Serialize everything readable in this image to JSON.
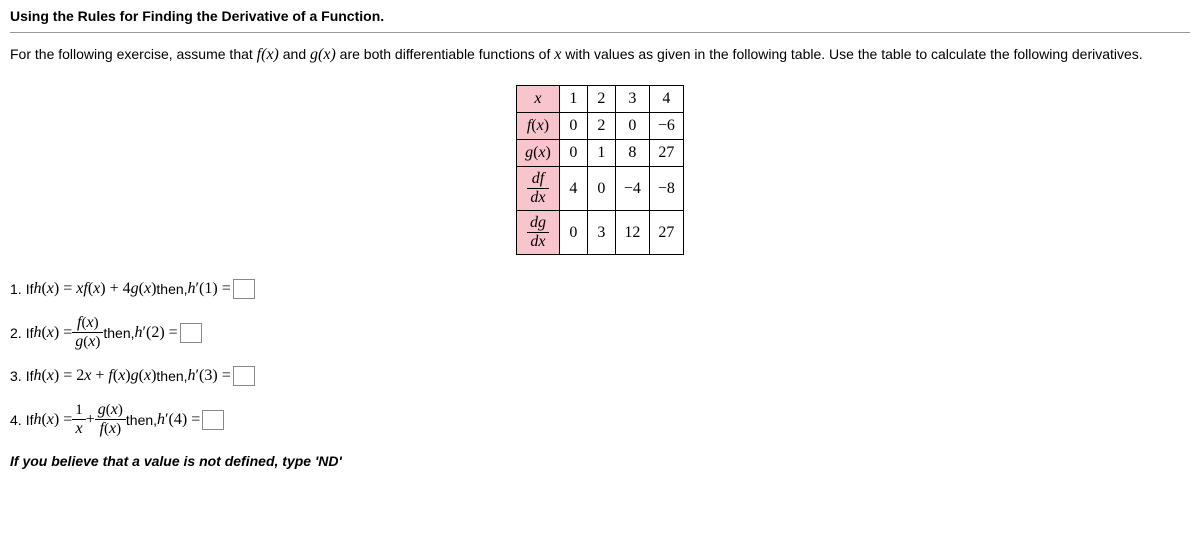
{
  "heading": "Using the Rules for Finding the Derivative of a Function.",
  "instructions_pre": "For the following exercise, assume that ",
  "instructions_f": "f(x)",
  "instructions_mid": " and ",
  "instructions_g": "g(x)",
  "instructions_post": " are both differentiable functions of ",
  "instructions_var": "x",
  "instructions_end": " with values as given in the following table. Use the table to calculate the following derivatives.",
  "table": {
    "rows": [
      {
        "label_html": "x",
        "vals": [
          "1",
          "2",
          "3",
          "4"
        ]
      },
      {
        "label_html": "f(x)",
        "vals": [
          "0",
          "2",
          "0",
          "−6"
        ]
      },
      {
        "label_html": "g(x)",
        "vals": [
          "0",
          "1",
          "8",
          "27"
        ]
      },
      {
        "label_html": "df/dx",
        "vals": [
          "4",
          "0",
          "−4",
          "−8"
        ]
      },
      {
        "label_html": "dg/dx",
        "vals": [
          "0",
          "3",
          "12",
          "27"
        ]
      }
    ]
  },
  "p1": {
    "num": "1. ",
    "if": "If ",
    "h": "h(x) = xf(x) + 4g(x)",
    "then": " then, ",
    "hp": "h′(1) ="
  },
  "p2": {
    "num": "2. ",
    "if": "If ",
    "h_left": "h(x) = ",
    "frac_num": "f(x)",
    "frac_den": "g(x)",
    "then": " then, ",
    "hp": "h′(2) ="
  },
  "p3": {
    "num": "3. ",
    "if": "If ",
    "h": "h(x) = 2x + f(x)g(x)",
    "then": " then, ",
    "hp": "h′(3) ="
  },
  "p4": {
    "num": "4. ",
    "if": "If ",
    "h_left": "h(x) = ",
    "frac1_num": "1",
    "frac1_den": "x",
    "plus": " + ",
    "frac2_num": "g(x)",
    "frac2_den": "f(x)",
    "then": " then, ",
    "hp": "h′(4) ="
  },
  "note": "If you believe that a value is not defined, type 'ND'",
  "chart_data": {
    "type": "table",
    "columns": [
      "x",
      "f(x)",
      "g(x)",
      "df/dx",
      "dg/dx"
    ],
    "rows": [
      {
        "x": 1,
        "f(x)": 0,
        "g(x)": 0,
        "df/dx": 4,
        "dg/dx": 0
      },
      {
        "x": 2,
        "f(x)": 2,
        "g(x)": 1,
        "df/dx": 0,
        "dg/dx": 3
      },
      {
        "x": 3,
        "f(x)": 0,
        "g(x)": 8,
        "df/dx": -4,
        "dg/dx": 12
      },
      {
        "x": 4,
        "f(x)": -6,
        "g(x)": 27,
        "df/dx": -8,
        "dg/dx": 27
      }
    ]
  }
}
